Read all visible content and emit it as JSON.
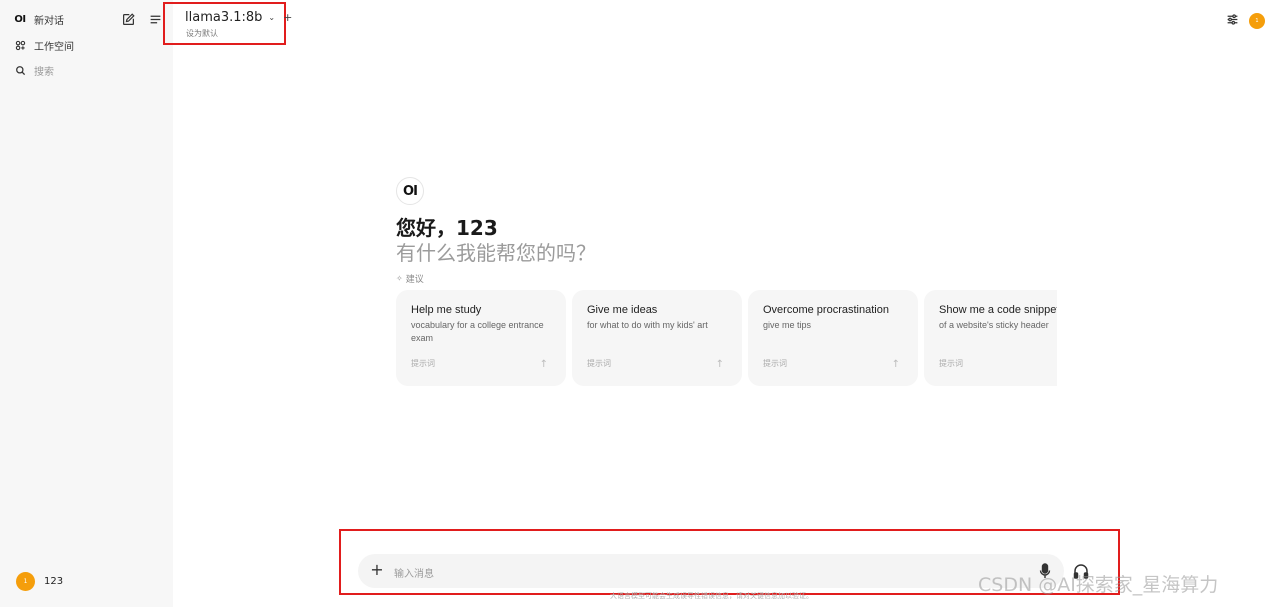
{
  "sidebar": {
    "logo": "OI",
    "new_chat": "新对话",
    "workspace": "工作空间",
    "search": "搜索",
    "user_name": "123",
    "user_initial": "1"
  },
  "header": {
    "model_name": "llama3.1:8b",
    "set_default": "设为默认",
    "user_initial": "1"
  },
  "main": {
    "logo": "OI",
    "greeting": "您好，123",
    "subgreeting": "有什么我能帮您的吗？",
    "suggest_label": "建议",
    "suggestions": [
      {
        "title": "Help me study",
        "subtitle": "vocabulary for a college entrance exam",
        "prompt_label": "提示词"
      },
      {
        "title": "Give me ideas",
        "subtitle": "for what to do with my kids' art",
        "prompt_label": "提示词"
      },
      {
        "title": "Overcome procrastination",
        "subtitle": "give me tips",
        "prompt_label": "提示词"
      },
      {
        "title": "Show me a code snippet",
        "subtitle": "of a website's sticky header",
        "prompt_label": "提示词"
      }
    ]
  },
  "input": {
    "placeholder": "输入消息",
    "disclaimer": "大语言模型可能会生成误导性错误信息，请对关键信息加以验证。"
  },
  "watermark": "CSDN @AI探索家_星海算力",
  "colors": {
    "accent_avatar": "#f59e0b",
    "highlight_box": "#e11d1d"
  }
}
